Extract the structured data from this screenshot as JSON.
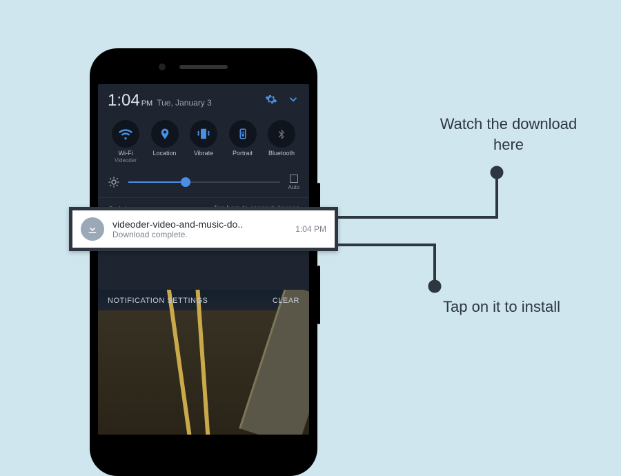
{
  "statusbar": {
    "time": "1:04",
    "ampm": "PM",
    "date": "Tue, January 3"
  },
  "toggles": [
    {
      "icon": "wifi",
      "label": "Wi-Fi",
      "sublabel": "Videoder",
      "active": true
    },
    {
      "icon": "location",
      "label": "Location",
      "sublabel": "",
      "active": true
    },
    {
      "icon": "vibrate",
      "label": "Vibrate",
      "sublabel": "",
      "active": true
    },
    {
      "icon": "portrait",
      "label": "Portrait",
      "sublabel": "",
      "active": true
    },
    {
      "icon": "bluetooth",
      "label": "Bluetooth",
      "sublabel": "",
      "active": false
    }
  ],
  "brightness": {
    "auto_label": "Auto",
    "percent": 38
  },
  "quick_connect": {
    "label": "Quick connect",
    "hint": "Tap here to connect devices"
  },
  "notif_actions": {
    "settings": "NOTIFICATION SETTINGS",
    "clear": "CLEAR"
  },
  "notification": {
    "title": "videoder-video-and-music-do..",
    "subtitle": "Download complete.",
    "time": "1:04 PM"
  },
  "callouts": {
    "watch": "Watch the download here",
    "install": "Tap on it to install"
  },
  "colors": {
    "accent": "#4a8fe6",
    "panel": "#1e2430",
    "callout": "#2e3740"
  }
}
